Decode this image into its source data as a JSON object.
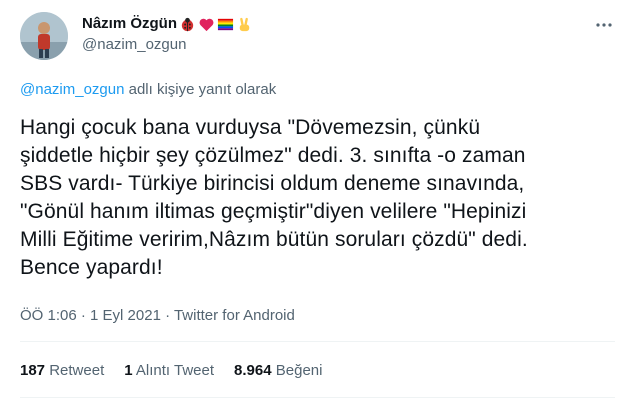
{
  "user": {
    "display_name": "Nâzım Özgün",
    "handle": "@nazim_ozgun"
  },
  "more_icon": "more-horizontal-icon",
  "reply_context": {
    "mention": "@nazim_ozgun",
    "suffix": " adlı kişiye yanıt olarak"
  },
  "tweet": {
    "text": "Hangi çocuk bana vurduysa \"Dövemezsin, çünkü\nşiddetle hiçbir şey çözülmez\" dedi. 3. sınıfta -o zaman\nSBS vardı- Türkiye birincisi oldum deneme sınavında,\n\"Gönül hanım iltimas geçmiştir\"diyen velilere \"Hepinizi\nMilli Eğitime veririm,Nâzım bütün soruları çözdü\" dedi.\nBence yapardı!",
    "meta": "ÖÖ 1:06 · 1 Eyl 2021 · Twitter for Android"
  },
  "stats": {
    "retweets": "187",
    "retweets_label": "Retweet",
    "quotes": "1",
    "quotes_label": "Alıntı Tweet",
    "likes": "8.964",
    "likes_label": "Beğeni"
  },
  "colors": {
    "link": "#1d9bf0",
    "secondary_text": "#536471",
    "primary_text": "#0f1419"
  }
}
